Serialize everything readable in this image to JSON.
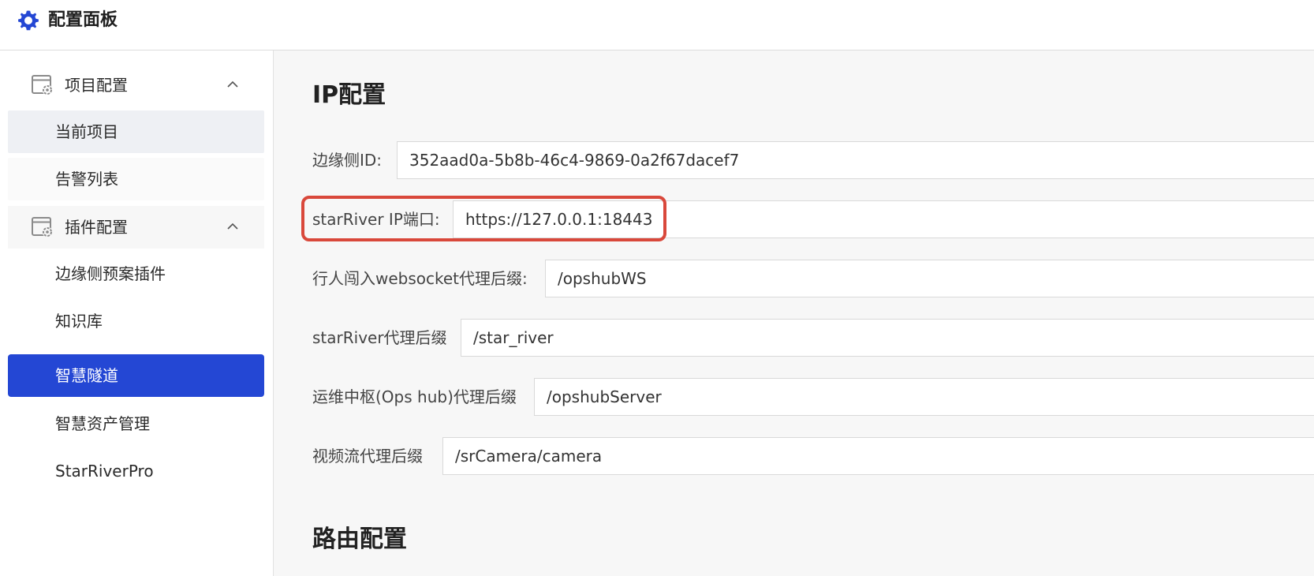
{
  "header": {
    "title": "配置面板",
    "icon": "gear-icon",
    "icon_color": "#2447d4"
  },
  "sidebar": {
    "groups": [
      {
        "label": "项目配置",
        "icon": "settings-window-icon",
        "expanded": true,
        "items": [
          {
            "label": "当前项目",
            "state": "hovered"
          },
          {
            "label": "告警列表",
            "state": "normal"
          }
        ]
      },
      {
        "label": "插件配置",
        "icon": "settings-window-icon",
        "expanded": true,
        "items": [
          {
            "label": "边缘侧预案插件",
            "state": "normal"
          },
          {
            "label": "知识库",
            "state": "normal"
          },
          {
            "label": "智慧隧道",
            "state": "active"
          },
          {
            "label": "智慧资产管理",
            "state": "normal"
          },
          {
            "label": "StarRiverPro",
            "state": "normal"
          }
        ]
      }
    ],
    "active_color": "#2447d4"
  },
  "main": {
    "ip_section": {
      "title": "IP配置",
      "fields": [
        {
          "label": "边缘侧ID:",
          "value": "352aad0a-5b8b-46c4-9869-0a2f67dacef7"
        },
        {
          "label": "starRiver IP端口:",
          "value": "https://127.0.0.1:18443",
          "highlighted": true
        },
        {
          "label": "行人闯入websocket代理后缀:",
          "value": "/opshubWS"
        },
        {
          "label": "starRiver代理后缀",
          "value": "/star_river"
        },
        {
          "label": "运维中枢(Ops hub)代理后缀",
          "value": "/opshubServer"
        },
        {
          "label": "视频流代理后缀",
          "value": "/srCamera/camera"
        }
      ]
    },
    "route_section": {
      "title": "路由配置"
    },
    "highlight_color": "#d9483b"
  }
}
